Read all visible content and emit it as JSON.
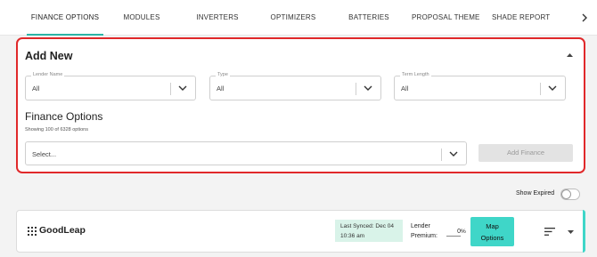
{
  "tabs": {
    "items": [
      {
        "label": "FINANCE OPTIONS"
      },
      {
        "label": "MODULES"
      },
      {
        "label": "INVERTERS"
      },
      {
        "label": "OPTIMIZERS"
      },
      {
        "label": "BATTERIES"
      },
      {
        "label": "PROPOSAL THEME"
      },
      {
        "label": "SHADE REPORT"
      }
    ],
    "active": "FINANCE OPTIONS",
    "next_icon": "chevron-right-icon"
  },
  "add_new": {
    "title": "Add New",
    "collapse_icon": "caret-up-icon",
    "filters": {
      "lender_name": {
        "legend": "Lender Name",
        "value": "All"
      },
      "type": {
        "legend": "Type",
        "value": "All"
      },
      "term_length": {
        "legend": "Term Length",
        "value": "All"
      }
    },
    "finance_options": {
      "title": "Finance Options",
      "subtitle": "Showing 100 of 6328 options",
      "select_placeholder": "Select...",
      "add_button": "Add Finance"
    }
  },
  "show_expired": {
    "label": "Show Expired",
    "enabled": false
  },
  "lender": {
    "name": "GoodLeap",
    "synced_line1": "Last Synced: Dec 04",
    "synced_line2": "10:36 am",
    "premium_label_line1": "Lender",
    "premium_label_line2": "Premium:",
    "premium_value": "0",
    "premium_unit": "%",
    "map_line1": "Map",
    "map_line2": "Options"
  },
  "colors": {
    "accent": "#3fd6c8",
    "highlight_border": "#e0282a",
    "synced_bg": "#d9f3e9"
  }
}
